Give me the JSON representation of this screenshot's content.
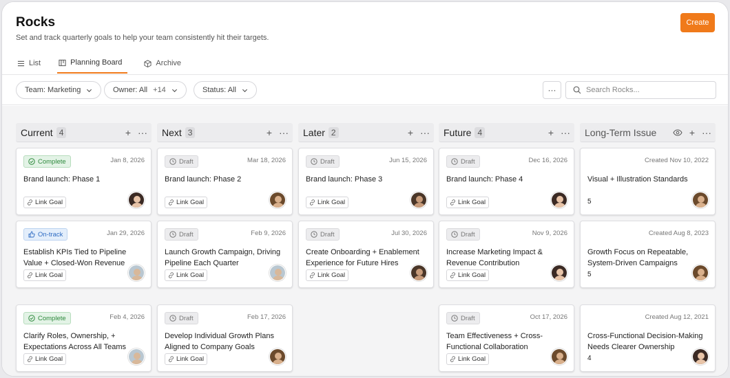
{
  "header": {
    "title": "Rocks",
    "subtitle": "Set and track quarterly goals to help your team consistently hit their targets.",
    "create_label": "Create",
    "tabs": [
      {
        "label": "List",
        "icon": "list-icon"
      },
      {
        "label": "Planning Board",
        "icon": "board-icon",
        "active": true
      },
      {
        "label": "Archive",
        "icon": "archive-icon"
      }
    ]
  },
  "filters": {
    "team": "Team: Marketing",
    "owner_label": "Owner: All",
    "owner_extra": "+14",
    "status": "Status: All",
    "more": "···",
    "search_placeholder": "Search Rocks..."
  },
  "colors": {
    "accent": "#f07a1a",
    "complete": "#2f8a3e",
    "ontrack": "#2d6bc2",
    "draft": "#777777"
  },
  "columns": [
    {
      "title": "Current",
      "count": "4",
      "cards": [
        {
          "status": "Complete",
          "status_type": "complete",
          "date": "Jan 8, 2026",
          "title": "Brand launch: Phase 1",
          "link": "Link Goal",
          "avatar": "female-dark-hair"
        },
        {
          "status": "On-track",
          "status_type": "ontrack",
          "date": "Jan 29, 2026",
          "title": "Establish KPIs Tied to Pipeline Value + Closed-Won Revenue",
          "link": "Link Goal",
          "avatar": "male-light"
        },
        {
          "status": "Complete",
          "status_type": "complete",
          "date": "Feb 4, 2026",
          "title": "Clarify Roles, Ownership, + Expectations Across All Teams",
          "link": "Link Goal",
          "avatar": "male-light"
        }
      ]
    },
    {
      "title": "Next",
      "count": "3",
      "cards": [
        {
          "status": "Draft",
          "status_type": "draft",
          "date": "Mar 18, 2026",
          "title": "Brand launch: Phase 2",
          "link": "Link Goal",
          "avatar": "female-curly"
        },
        {
          "status": "Draft",
          "status_type": "draft",
          "date": "Feb 9, 2026",
          "title": "Launch Growth Campaign, Driving Pipeline Each Quarter",
          "link": "Link Goal",
          "avatar": "male-light"
        },
        {
          "status": "Draft",
          "status_type": "draft",
          "date": "Feb 17, 2026",
          "title": "Develop Individual Growth Plans Aligned to Company Goals",
          "link": "Link Goal",
          "avatar": "female-curly"
        }
      ]
    },
    {
      "title": "Later",
      "count": "2",
      "cards": [
        {
          "status": "Draft",
          "status_type": "draft",
          "date": "Jun 15, 2026",
          "title": "Brand launch: Phase 3",
          "link": "Link Goal",
          "avatar": "male-beard"
        },
        {
          "status": "Draft",
          "status_type": "draft",
          "date": "Jul 30, 2026",
          "title": "Create Onboarding + Enablement Experience for Future Hires",
          "link": "Link Goal",
          "avatar": "male-beard"
        }
      ]
    },
    {
      "title": "Future",
      "count": "4",
      "cards": [
        {
          "status": "Draft",
          "status_type": "draft",
          "date": "Dec 16, 2026",
          "title": "Brand launch: Phase 4",
          "link": "Link Goal",
          "avatar": "female-dark-hair"
        },
        {
          "status": "Draft",
          "status_type": "draft",
          "date": "Nov 9, 2026",
          "title": "Increase Marketing Impact & Revenue Contribution",
          "link": "Link Goal",
          "avatar": "female-dark-hair"
        },
        {
          "status": "Draft",
          "status_type": "draft",
          "date": "Oct 17, 2026",
          "title": "Team Effectiveness + Cross-Functional Collaboration",
          "link": "Link Goal",
          "avatar": "female-curly"
        }
      ]
    },
    {
      "title": "Long-Term Issue",
      "count": "",
      "cards": [
        {
          "date": "Created Nov 10, 2022",
          "title": "Visual + Illustration Standards",
          "issue_count": "5",
          "avatar": "female-curly"
        },
        {
          "date": "Created Aug 8, 2023",
          "title": "Growth Focus on Repeatable, System-Driven Campaigns",
          "issue_count": "5",
          "avatar": "female-curly"
        },
        {
          "date": "Created Aug 12, 2021",
          "title": "Cross-Functional Decision-Making Needs Clearer Ownership",
          "issue_count": "4",
          "avatar": "female-dark-hair"
        }
      ]
    }
  ]
}
